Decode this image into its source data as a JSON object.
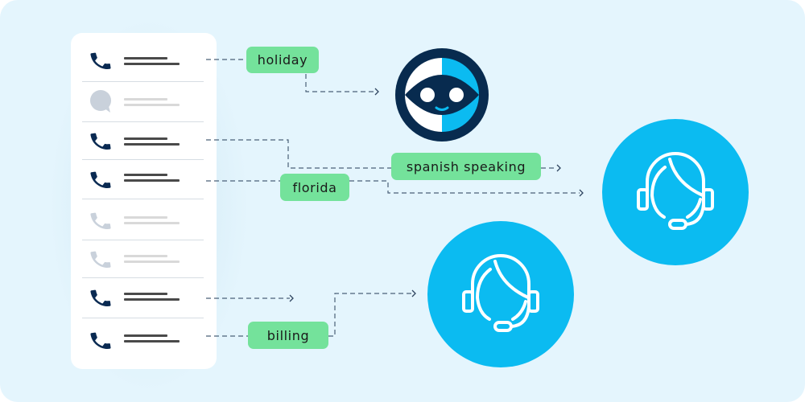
{
  "colors": {
    "background": "#e4f5fd",
    "panel": "#ffffff",
    "tag_green": "#74e29b",
    "agent_blue": "#0bbbf1",
    "navy": "#082b4f",
    "phone_active": "#0a2a52",
    "phone_inactive": "#c9d1db",
    "connector": "#4a6078"
  },
  "call_list": {
    "items": [
      {
        "type": "phone",
        "state": "active",
        "icon": "phone-icon"
      },
      {
        "type": "chat",
        "state": "inactive",
        "icon": "chat-bubble-icon"
      },
      {
        "type": "phone",
        "state": "active",
        "icon": "phone-icon"
      },
      {
        "type": "phone",
        "state": "active",
        "icon": "phone-icon"
      },
      {
        "type": "phone",
        "state": "inactive",
        "icon": "phone-icon"
      },
      {
        "type": "phone",
        "state": "inactive",
        "icon": "phone-icon"
      },
      {
        "type": "phone",
        "state": "active",
        "icon": "phone-icon"
      },
      {
        "type": "phone",
        "state": "active",
        "icon": "phone-icon"
      }
    ]
  },
  "tags": {
    "holiday": "holiday",
    "spanish": "spanish speaking",
    "florida": "florida",
    "billing": "billing"
  },
  "nodes": {
    "bot": {
      "icon": "chatbot-face-icon"
    },
    "agent_large": {
      "icon": "headset-agent-icon"
    },
    "agent_small": {
      "icon": "headset-agent-icon"
    }
  }
}
